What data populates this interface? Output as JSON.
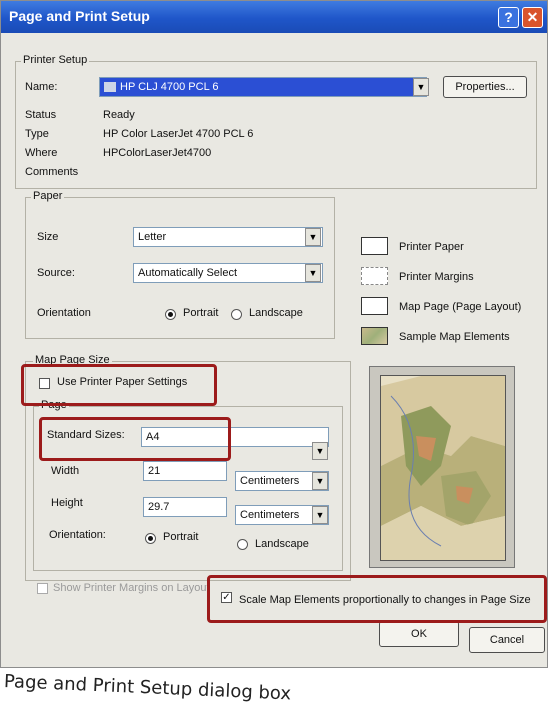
{
  "window": {
    "title": "Page and Print Setup",
    "help_glyph": "?",
    "close_glyph": "✕"
  },
  "printer_setup": {
    "group_title": "Printer Setup",
    "name_label": "Name:",
    "name_value": "HP CLJ 4700 PCL 6",
    "properties_button": "Properties...",
    "status_label": "Status",
    "status_value": "Ready",
    "type_label": "Type",
    "type_value": "HP Color LaserJet 4700 PCL 6",
    "where_label": "Where",
    "where_value": "HPColorLaserJet4700",
    "comments_label": "Comments"
  },
  "paper": {
    "group_title": "Paper",
    "size_label": "Size",
    "size_value": "Letter",
    "source_label": "Source:",
    "source_value": "Automatically Select",
    "orientation_label": "Orientation",
    "portrait_label": "Portrait",
    "landscape_label": "Landscape",
    "orientation_selected": "Portrait"
  },
  "legend": {
    "printer_paper": "Printer Paper",
    "printer_margins": "Printer Margins",
    "map_page": "Map Page (Page Layout)",
    "sample_map_elements": "Sample Map Elements"
  },
  "map_page_size": {
    "group_title": "Map Page Size",
    "use_printer_paper_settings": "Use Printer Paper Settings",
    "use_printer_paper_checked": false,
    "page_title": "Page",
    "standard_sizes_label": "Standard Sizes:",
    "standard_sizes_value": "A4",
    "width_label": "Width",
    "width_value": "21",
    "width_units": "Centimeters",
    "height_label": "Height",
    "height_value": "29.7",
    "height_units": "Centimeters",
    "orientation_label": "Orientation:",
    "portrait_label": "Portrait",
    "landscape_label": "Landscape",
    "orientation_selected": "Portrait"
  },
  "bottom": {
    "show_printer_margins": "Show Printer Margins on Layout",
    "show_printer_margins_checked": false,
    "scale_map_elements": "Scale Map Elements proportionally to changes in Page Size",
    "scale_map_elements_checked": true,
    "ok_button": "OK",
    "cancel_button": "Cancel"
  },
  "caption": "Page and Print Setup dialog box",
  "colors": {
    "title_bar": "#1f56c9",
    "highlight": "#9c1b1b",
    "selection": "#2b4fd4"
  }
}
